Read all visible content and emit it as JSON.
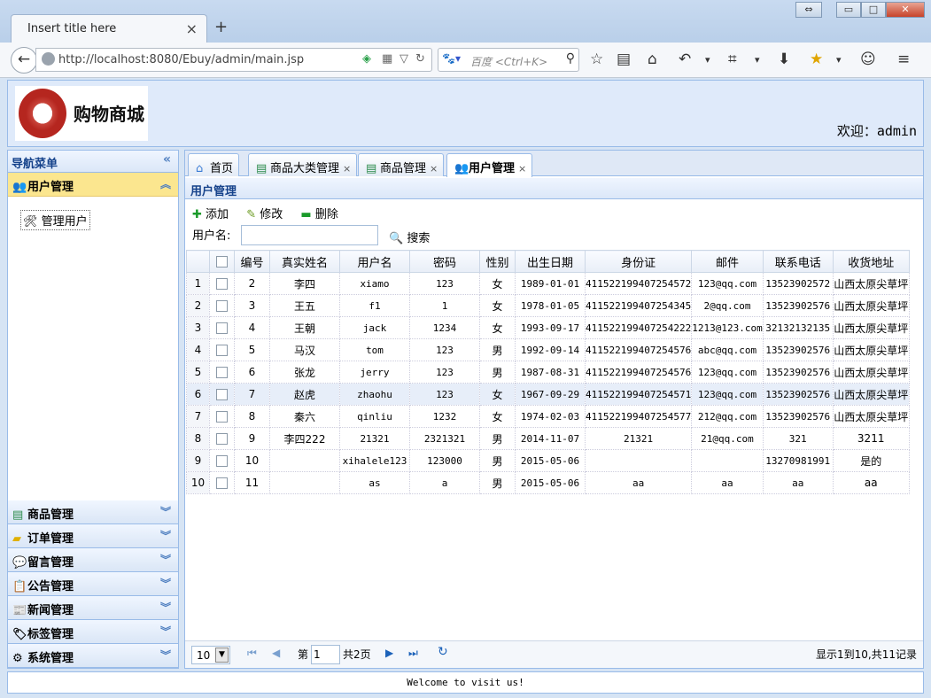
{
  "browser": {
    "tab_title": "Insert title here",
    "url": "http://localhost:8080/Ebuy/admin/main.jsp",
    "search_placeholder": "百度 <Ctrl+K>"
  },
  "header": {
    "logo_text": "购物商城",
    "welcome": "欢迎：admin"
  },
  "sidebar": {
    "title": "导航菜单",
    "open_section": "用户管理",
    "open_item": "管理用户",
    "sections": [
      "商品管理",
      "订单管理",
      "留言管理",
      "公告管理",
      "新闻管理",
      "标签管理",
      "系统管理"
    ]
  },
  "tabs": [
    "首页",
    "商品大类管理",
    "商品管理",
    "用户管理"
  ],
  "panel": {
    "title": "用户管理",
    "add": "添加",
    "edit": "修改",
    "delete": "删除",
    "filter_label": "用户名:",
    "search": "搜索"
  },
  "grid": {
    "columns": [
      "编号",
      "真实姓名",
      "用户名",
      "密码",
      "性别",
      "出生日期",
      "身份证",
      "邮件",
      "联系电话",
      "收货地址"
    ],
    "rows": [
      [
        "2",
        "李四",
        "xiamo",
        "123",
        "女",
        "1989-01-01",
        "411522199407254572",
        "123@qq.com",
        "13523902572",
        "山西太原尖草坪"
      ],
      [
        "3",
        "王五",
        "f1",
        "1",
        "女",
        "1978-01-05",
        "411522199407254345",
        "2@qq.com",
        "13523902576",
        "山西太原尖草坪"
      ],
      [
        "4",
        "王朝",
        "jack",
        "1234",
        "女",
        "1993-09-17",
        "411522199407254222",
        "1213@123.com",
        "32132132135",
        "山西太原尖草坪"
      ],
      [
        "5",
        "马汉",
        "tom",
        "123",
        "男",
        "1992-09-14",
        "411522199407254576",
        "abc@qq.com",
        "13523902576",
        "山西太原尖草坪"
      ],
      [
        "6",
        "张龙",
        "jerry",
        "123",
        "男",
        "1987-08-31",
        "411522199407254576",
        "123@qq.com",
        "13523902576",
        "山西太原尖草坪"
      ],
      [
        "7",
        "赵虎",
        "zhaohu",
        "123",
        "女",
        "1967-09-29",
        "411522199407254571",
        "123@qq.com",
        "13523902576",
        "山西太原尖草坪"
      ],
      [
        "8",
        "秦六",
        "qinliu",
        "1232",
        "女",
        "1974-02-03",
        "411522199407254577",
        "212@qq.com",
        "13523902576",
        "山西太原尖草坪"
      ],
      [
        "9",
        "李四222",
        "21321",
        "2321321",
        "男",
        "2014-11-07",
        "21321",
        "21@qq.com",
        "321",
        "3211"
      ],
      [
        "10",
        "",
        "xihalele123",
        "123000",
        "男",
        "2015-05-06",
        "",
        "",
        "13270981991",
        "是的"
      ],
      [
        "11",
        "",
        "as",
        "a",
        "男",
        "2015-05-06",
        "aa",
        "aa",
        "aa",
        "aa"
      ]
    ]
  },
  "pager": {
    "page_size": "10",
    "page_prefix": "第",
    "page_num": "1",
    "page_total": "共2页",
    "summary": "显示1到10,共11记录"
  },
  "footer": "Welcome to visit us!"
}
